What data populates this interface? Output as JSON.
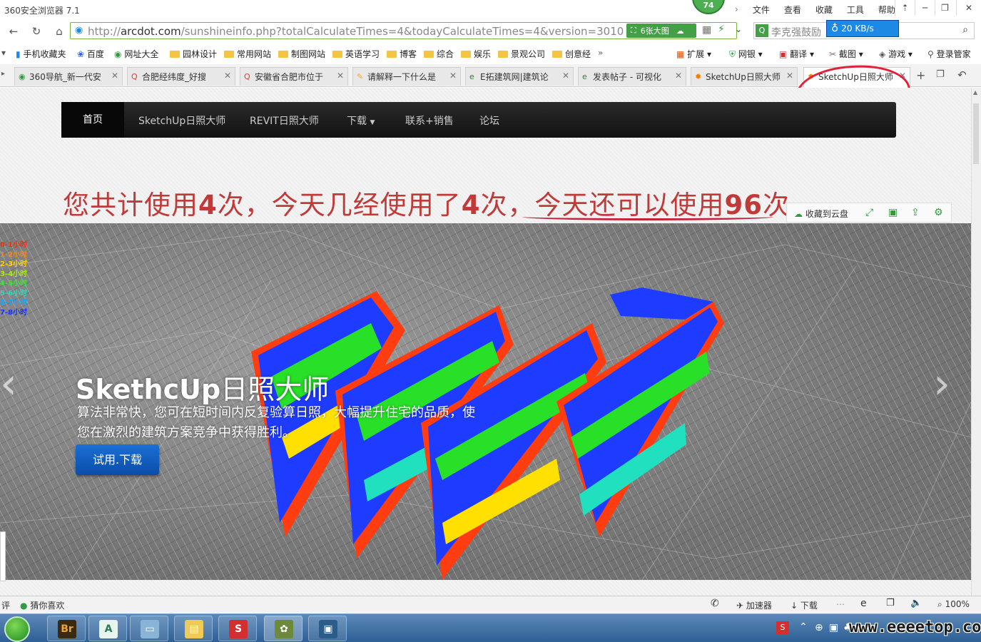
{
  "window": {
    "title": "360安全浏览器 7.1",
    "badge": "74",
    "menu": [
      "文件",
      "查看",
      "收藏",
      "工具",
      "帮助"
    ]
  },
  "address": {
    "url_prefix": "http://",
    "url_host": "arcdot.com",
    "url_path": "/sunshineinfo.php?totalCalculateTimes=4&todayCalculateTimes=4&version=3010",
    "big_pic_label": "6张大图",
    "search_text": "李克强鼓励",
    "speed": "20 KB/s"
  },
  "bookmarks": [
    "手机收藏夹",
    "百度",
    "网址大全",
    "园林设计",
    "常用网站",
    "制图网站",
    "英语学习",
    "博客",
    "综合",
    "娱乐",
    "景观公司",
    "创意经"
  ],
  "bookmarks_right": [
    "扩展",
    "网银",
    "翻译",
    "截图",
    "游戏",
    "登录管家"
  ],
  "tabs": [
    "360导航_新一代安",
    "合肥经纬度_好搜",
    "安徽省合肥市位于",
    "请解释一下什么是",
    "E拓建筑网|建筑论",
    "发表帖子 - 可视化",
    "SketchUp日照大师",
    "SketchUp日照大师"
  ],
  "site": {
    "nav": [
      "首页",
      "SketchUp日照大师",
      "REVIT日照大师",
      "下载",
      "联系+销售",
      "论坛"
    ],
    "headline_a": "您共计使用",
    "headline_n1": "4",
    "headline_b": "次，今天几经使用了",
    "headline_n2": "4",
    "headline_c": "次，",
    "headline_d": "今天还可以使用",
    "headline_n3": "96",
    "headline_e": "次",
    "cloud_label": "收藏到云盘",
    "legend": [
      "0-1小时",
      "1-2小时",
      "2-3小时",
      "3-4小时",
      "4-5小时",
      "5-6小时",
      "6-7小时",
      "7-8小时"
    ],
    "legend_colors": [
      "#ff2a00",
      "#ff8a00",
      "#ffd000",
      "#aaf000",
      "#2cf02c",
      "#20e0c0",
      "#10a8ff",
      "#1830ff"
    ],
    "hero_title_latin": "SkethcUp",
    "hero_title_cn": "日照大师",
    "hero_desc": "算法非常快，您可在短时间内反复验算日照，大幅提升住宅的品质，使您在激烈的建筑方案竞争中获得胜利。",
    "hero_button": "试用.下载"
  },
  "status": {
    "left": "评",
    "guess": "猜你喜欢",
    "accelerator": "加速器",
    "download": "下载",
    "zoom": "100%"
  },
  "watermark": "www.eeeetop.com"
}
